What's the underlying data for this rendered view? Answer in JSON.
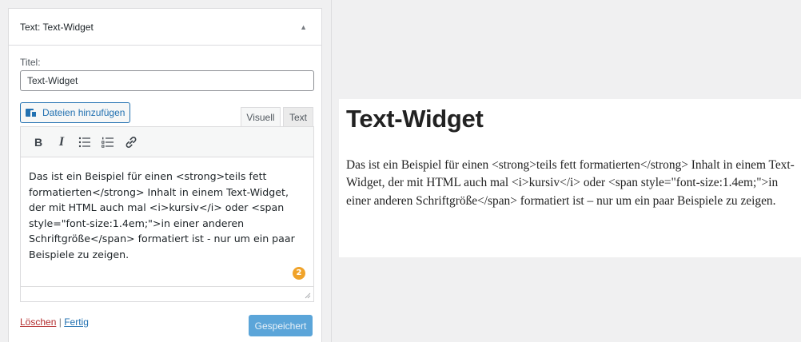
{
  "widget": {
    "header_title": "Text: Text-Widget",
    "title_label": "Titel:",
    "title_value": "Text-Widget",
    "media_button_label": "Dateien hinzufügen",
    "tabs": [
      {
        "label": "Visuell"
      },
      {
        "label": "Text"
      }
    ],
    "toolbar": [
      {
        "name": "bold",
        "glyph": "B"
      },
      {
        "name": "italic",
        "glyph": "I"
      },
      {
        "name": "bulleted-list",
        "icon": "bullet-list-icon"
      },
      {
        "name": "numbered-list",
        "icon": "numbered-list-icon"
      },
      {
        "name": "link",
        "icon": "link-icon"
      }
    ],
    "content": "Das ist ein Beispiel für einen <strong>teils fett formatierten</strong> Inhalt in einem Text-Widget, der mit HTML auch mal <i>kursiv</i> oder <span style=\"font-size:1.4em;\">in einer anderen Schriftgröße</span> formatiert ist - nur um ein paar Beispiele zu zeigen.",
    "badge_count": "2",
    "delete_link": "Löschen",
    "separator": "|",
    "done_link": "Fertig",
    "save_button": "Gespeichert",
    "collapse_icon": "triangle-up-icon"
  },
  "preview": {
    "title": "Text-Widget",
    "body": "Das ist ein Beispiel für einen <strong>teils fett formatierten</strong> Inhalt in einem Text-Widget, der mit HTML auch mal <i>kursiv</i> oder <span style=\"font-size:1.4em;\">in einer anderen Schriftgröße</span> formatiert ist – nur um ein paar Beispiele zu zeigen."
  },
  "colors": {
    "accent": "#2271b1",
    "save_button_bg": "#5ba5d9",
    "badge": "#f0a32a",
    "delete_link": "#b32d2e"
  }
}
